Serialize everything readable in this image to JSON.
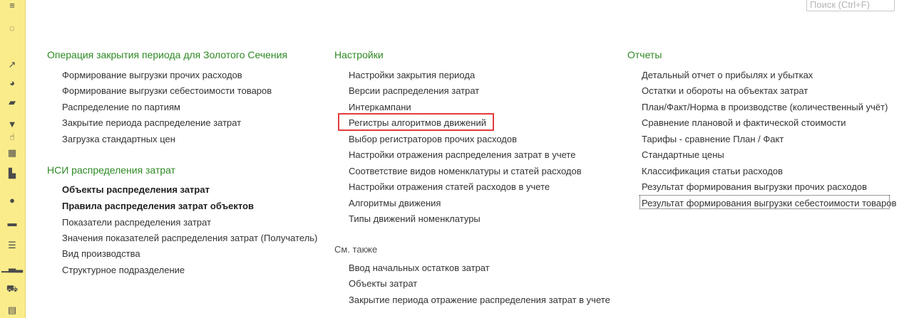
{
  "search": {
    "placeholder": "Поиск (Ctrl+F)"
  },
  "sidebar": {
    "icons": [
      "menu-icon",
      "spinner-icon",
      "chart-line-icon",
      "pie-chart-icon",
      "shopping-bag-icon",
      "cart-icon",
      "grid-icon",
      "factory-icon",
      "user-icon",
      "card-icon",
      "coins-icon",
      "bar-chart-icon",
      "car-icon",
      "calculator-icon"
    ]
  },
  "columns": [
    {
      "heading": "Операция закрытия периода для Золотого Сечения",
      "items": [
        "Формирование выгрузки прочих расходов",
        "Формирование выгрузки себестоимости товаров",
        "Распределение по партиям",
        "Закрытие периода распределение затрат",
        "Загрузка стандартных цен"
      ],
      "heading2": "НСИ распределения затрат",
      "items2": [
        "Объекты распределения затрат",
        "Правила распределения затрат объектов",
        "Показатели распределения затрат",
        "Значения показателей распределения затрат (Получатель)",
        "Вид производства",
        "Структурное подразделение"
      ]
    },
    {
      "heading": "Настройки",
      "items": [
        "Настройки закрытия периода",
        "Версии распределения затрат",
        "Интеркампани",
        "Регистры алгоритмов движений",
        "Выбор регистраторов прочих расходов",
        "Настройки отражения распределения затрат в учете",
        "Соответствие видов номенклатуры и статей расходов",
        "Настройки отражения статей расходов в учете",
        "Алгоритмы движения",
        "Типы движений номенклатуры"
      ],
      "heading2": "См. также",
      "items2": [
        "Ввод начальных остатков затрат",
        "Объекты затрат",
        "Закрытие периода отражение распределения затрат в учете"
      ]
    },
    {
      "heading": "Отчеты",
      "items": [
        "Детальный отчет о прибылях и убытках",
        "Остатки и обороты на объектах затрат",
        "План/Факт/Норма в производстве (количественный учёт)",
        "Сравнение плановой и фактической стоимости",
        "Тарифы - сравнение План / Факт",
        "Стандартные цены",
        "Классификация статьи расходов",
        "Результат формирования выгрузки прочих расходов",
        "Результат формирования выгрузки себестоимости товаров"
      ]
    }
  ]
}
